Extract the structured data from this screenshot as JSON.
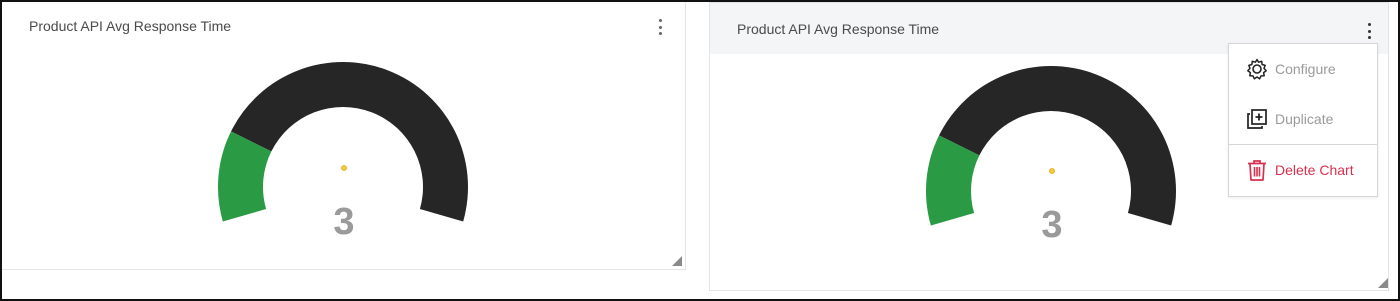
{
  "cards": [
    {
      "title": "Product API Avg Response Time",
      "gauge": {
        "value": "3",
        "filled_fraction": 0.2,
        "min": 0,
        "max": 15
      }
    },
    {
      "title": "Product API Avg Response Time",
      "gauge": {
        "value": "3",
        "filled_fraction": 0.2,
        "min": 0,
        "max": 15
      }
    }
  ],
  "menu": {
    "items": [
      {
        "label": "Configure",
        "icon": "gear-icon"
      },
      {
        "label": "Duplicate",
        "icon": "duplicate-icon"
      },
      {
        "label": "Delete Chart",
        "icon": "trash-icon"
      }
    ]
  },
  "colors": {
    "gauge_fill": "#2a9a45",
    "gauge_track": "#262626",
    "needle_dot": "#f5c842",
    "value_text": "#9a9a9a",
    "danger": "#d9304e"
  }
}
